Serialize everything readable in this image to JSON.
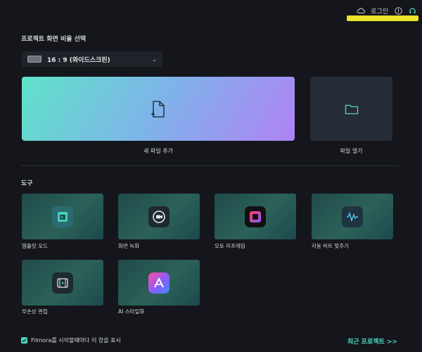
{
  "topbar": {
    "login_label": "로그인"
  },
  "project": {
    "heading": "프로젝트 화면 비율 선택",
    "ratio_value": "16 : 9 (와이드스크린)"
  },
  "actions": {
    "new_file_label": "새 파일 추가",
    "open_file_label": "파일 열기"
  },
  "tools": {
    "heading": "도구",
    "items": [
      {
        "label": "템플릿 모드"
      },
      {
        "label": "화면 녹화"
      },
      {
        "label": "오토 리프레임"
      },
      {
        "label": "자동 비트 맞추기"
      },
      {
        "label": "무손상 편집"
      },
      {
        "label": "AI 스타일화"
      }
    ]
  },
  "footer": {
    "startup_checkbox_label": "Filmora를 시작할때마다 이 창을 표시",
    "recent_projects_link": "최근 프로젝트 >>"
  },
  "colors": {
    "accent": "#4ed6bd",
    "background": "#14161b",
    "highlight": "#f6ee2a"
  }
}
